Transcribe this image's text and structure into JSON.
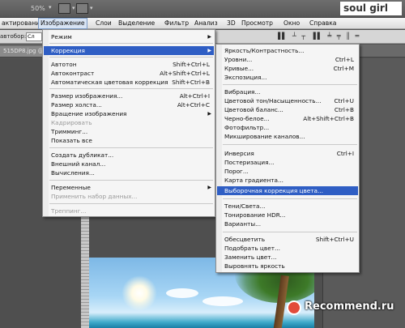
{
  "topbar": {
    "zoom": "50%",
    "brand": "soul girl"
  },
  "menubar": {
    "items": [
      "актирование",
      "Изображение",
      "Слои",
      "Выделение",
      "Фильтр",
      "Анализ",
      "3D",
      "Просмотр",
      "Окно",
      "Справка"
    ]
  },
  "options": {
    "label": "автобор:",
    "field": "Сл"
  },
  "tab": {
    "label": "515DP8.jpg @"
  },
  "image_menu": {
    "items": [
      {
        "label": "Режим",
        "submenu": true
      },
      {
        "label": "Коррекция",
        "submenu": true,
        "highlight": true
      },
      {
        "label": "Автотон",
        "shortcut": "Shift+Ctrl+L"
      },
      {
        "label": "Автоконтраст",
        "shortcut": "Alt+Shift+Ctrl+L"
      },
      {
        "label": "Автоматическая цветовая коррекция",
        "shortcut": "Shift+Ctrl+B"
      },
      {
        "label": "Размер изображения...",
        "shortcut": "Alt+Ctrl+I"
      },
      {
        "label": "Размер холста...",
        "shortcut": "Alt+Ctrl+C"
      },
      {
        "label": "Вращение изображения",
        "submenu": true
      },
      {
        "label": "Кадрировать",
        "disabled": true
      },
      {
        "label": "Тримминг..."
      },
      {
        "label": "Показать все"
      },
      {
        "label": "Создать дубликат..."
      },
      {
        "label": "Внешний канал..."
      },
      {
        "label": "Вычисления..."
      },
      {
        "label": "Переменные",
        "submenu": true
      },
      {
        "label": "Применить набор данных...",
        "disabled": true
      },
      {
        "label": "Треппинг...",
        "disabled": true
      }
    ]
  },
  "adjust_menu": {
    "items": [
      {
        "label": "Яркость/Контрастность..."
      },
      {
        "label": "Уровни...",
        "shortcut": "Ctrl+L"
      },
      {
        "label": "Кривые...",
        "shortcut": "Ctrl+M"
      },
      {
        "label": "Экспозиция..."
      },
      {
        "label": "Вибрация..."
      },
      {
        "label": "Цветовой тон/Насыщенность...",
        "shortcut": "Ctrl+U"
      },
      {
        "label": "Цветовой баланс...",
        "shortcut": "Ctrl+B"
      },
      {
        "label": "Черно-белое...",
        "shortcut": "Alt+Shift+Ctrl+B"
      },
      {
        "label": "Фотофильтр..."
      },
      {
        "label": "Микширование каналов..."
      },
      {
        "label": "Инверсия",
        "shortcut": "Ctrl+I"
      },
      {
        "label": "Постеризация..."
      },
      {
        "label": "Порог..."
      },
      {
        "label": "Карта градиента..."
      },
      {
        "label": "Выборочная коррекция цвета...",
        "highlight": true
      },
      {
        "label": "Тени/Света..."
      },
      {
        "label": "Тонирование HDR..."
      },
      {
        "label": "Варианты..."
      },
      {
        "label": "Обесцветить",
        "shortcut": "Shift+Ctrl+U"
      },
      {
        "label": "Подобрать цвет..."
      },
      {
        "label": "Заменить цвет..."
      },
      {
        "label": "Выровнять яркость"
      }
    ]
  },
  "watermark": "Recommend.ru"
}
